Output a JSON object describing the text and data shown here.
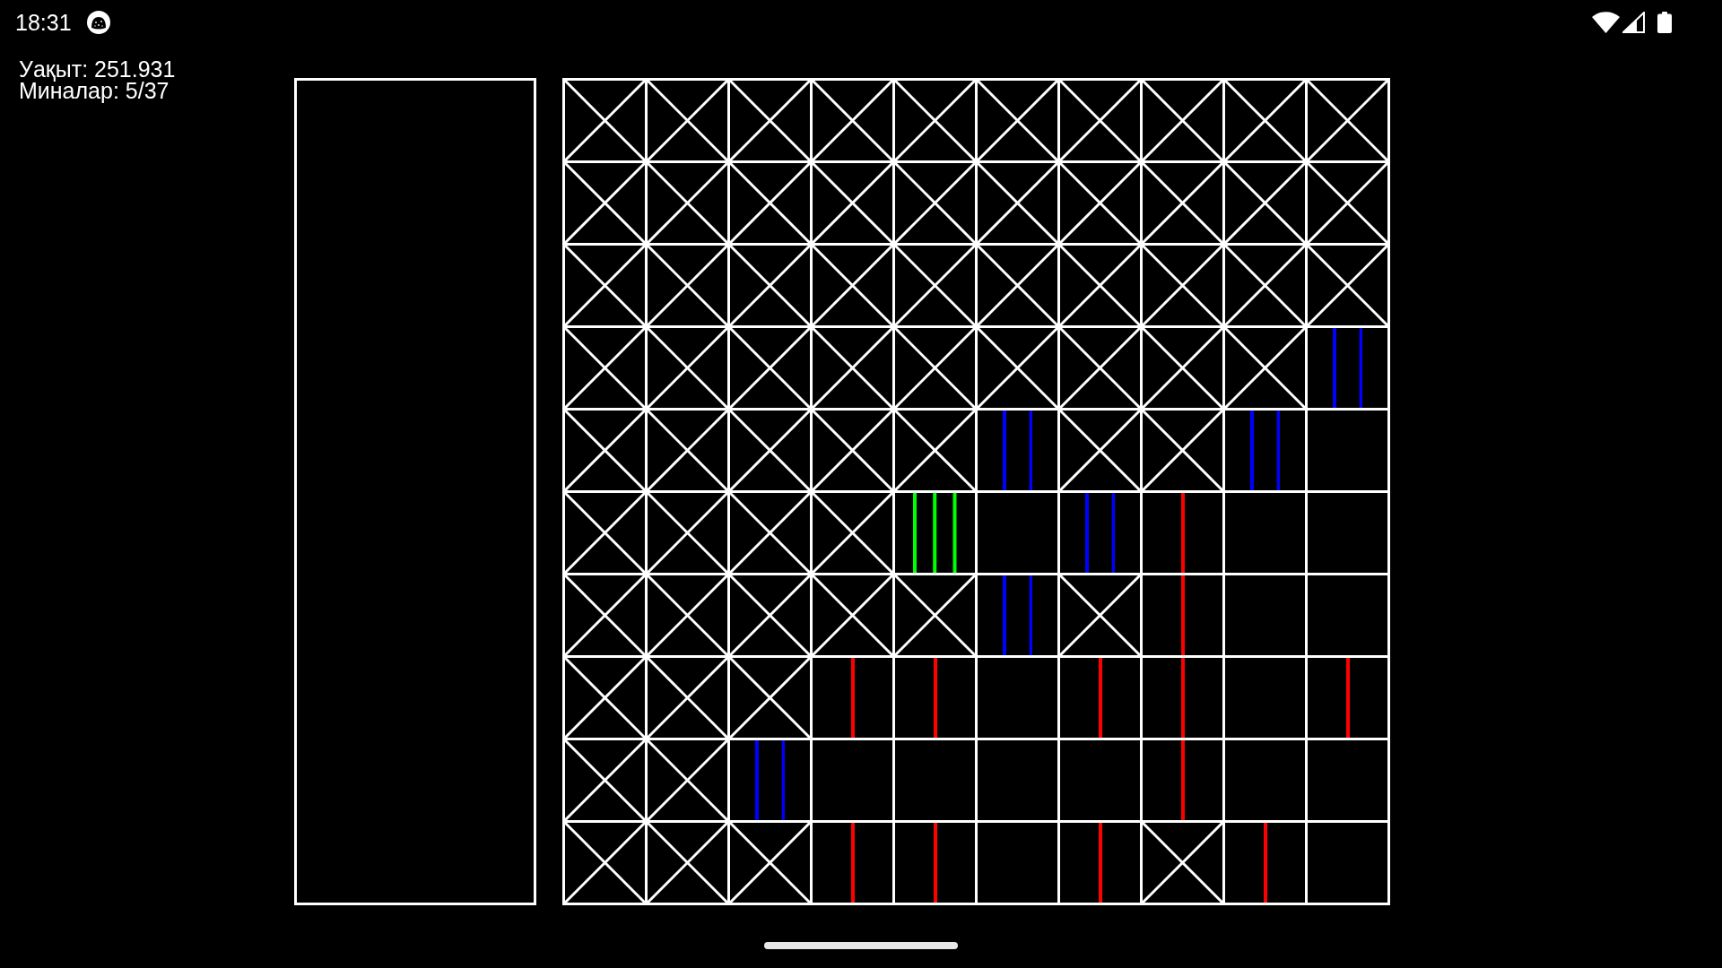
{
  "status_bar": {
    "time": "18:31"
  },
  "hud": {
    "timer": "Уақыт: 251.931",
    "mine_counter": "Миналар: 5/37"
  },
  "board": {
    "rows": [
      {
        "cells": [
          {
            "kind": "covered"
          },
          {
            "kind": "covered"
          },
          {
            "kind": "covered"
          },
          {
            "kind": "covered"
          },
          {
            "kind": "covered"
          },
          {
            "kind": "covered"
          },
          {
            "kind": "covered"
          },
          {
            "kind": "covered"
          },
          {
            "kind": "covered"
          },
          {
            "kind": "covered"
          }
        ]
      },
      {
        "cells": [
          {
            "kind": "covered"
          },
          {
            "kind": "covered"
          },
          {
            "kind": "covered"
          },
          {
            "kind": "covered"
          },
          {
            "kind": "covered"
          },
          {
            "kind": "covered"
          },
          {
            "kind": "covered"
          },
          {
            "kind": "covered"
          },
          {
            "kind": "covered"
          },
          {
            "kind": "covered"
          }
        ]
      },
      {
        "cells": [
          {
            "kind": "covered"
          },
          {
            "kind": "covered"
          },
          {
            "kind": "covered"
          },
          {
            "kind": "covered"
          },
          {
            "kind": "covered"
          },
          {
            "kind": "covered"
          },
          {
            "kind": "covered"
          },
          {
            "kind": "covered"
          },
          {
            "kind": "covered"
          },
          {
            "kind": "covered"
          }
        ]
      },
      {
        "cells": [
          {
            "kind": "covered"
          },
          {
            "kind": "covered"
          },
          {
            "kind": "covered"
          },
          {
            "kind": "covered"
          },
          {
            "kind": "covered"
          },
          {
            "kind": "covered"
          },
          {
            "kind": "covered"
          },
          {
            "kind": "covered"
          },
          {
            "kind": "covered"
          },
          {
            "kind": "two"
          }
        ]
      },
      {
        "cells": [
          {
            "kind": "covered"
          },
          {
            "kind": "covered"
          },
          {
            "kind": "covered"
          },
          {
            "kind": "covered"
          },
          {
            "kind": "covered"
          },
          {
            "kind": "two"
          },
          {
            "kind": "covered"
          },
          {
            "kind": "covered"
          },
          {
            "kind": "two"
          },
          {
            "kind": "empty"
          }
        ]
      },
      {
        "cells": [
          {
            "kind": "covered"
          },
          {
            "kind": "covered"
          },
          {
            "kind": "covered"
          },
          {
            "kind": "covered"
          },
          {
            "kind": "three"
          },
          {
            "kind": "empty"
          },
          {
            "kind": "two"
          },
          {
            "kind": "one"
          },
          {
            "kind": "empty"
          },
          {
            "kind": "empty"
          }
        ]
      },
      {
        "cells": [
          {
            "kind": "covered"
          },
          {
            "kind": "covered"
          },
          {
            "kind": "covered"
          },
          {
            "kind": "covered"
          },
          {
            "kind": "covered"
          },
          {
            "kind": "two"
          },
          {
            "kind": "covered"
          },
          {
            "kind": "one"
          },
          {
            "kind": "empty"
          },
          {
            "kind": "empty"
          }
        ]
      },
      {
        "cells": [
          {
            "kind": "covered"
          },
          {
            "kind": "covered"
          },
          {
            "kind": "covered"
          },
          {
            "kind": "one"
          },
          {
            "kind": "one"
          },
          {
            "kind": "empty"
          },
          {
            "kind": "one"
          },
          {
            "kind": "one"
          },
          {
            "kind": "empty"
          },
          {
            "kind": "one"
          }
        ]
      },
      {
        "cells": [
          {
            "kind": "covered"
          },
          {
            "kind": "covered"
          },
          {
            "kind": "two"
          },
          {
            "kind": "empty"
          },
          {
            "kind": "empty"
          },
          {
            "kind": "empty"
          },
          {
            "kind": "empty"
          },
          {
            "kind": "one"
          },
          {
            "kind": "empty"
          },
          {
            "kind": "empty"
          }
        ]
      },
      {
        "cells": [
          {
            "kind": "covered"
          },
          {
            "kind": "covered"
          },
          {
            "kind": "covered"
          },
          {
            "kind": "one"
          },
          {
            "kind": "one"
          },
          {
            "kind": "empty"
          },
          {
            "kind": "one"
          },
          {
            "kind": "covered"
          },
          {
            "kind": "one"
          },
          {
            "kind": "empty"
          }
        ]
      }
    ]
  }
}
